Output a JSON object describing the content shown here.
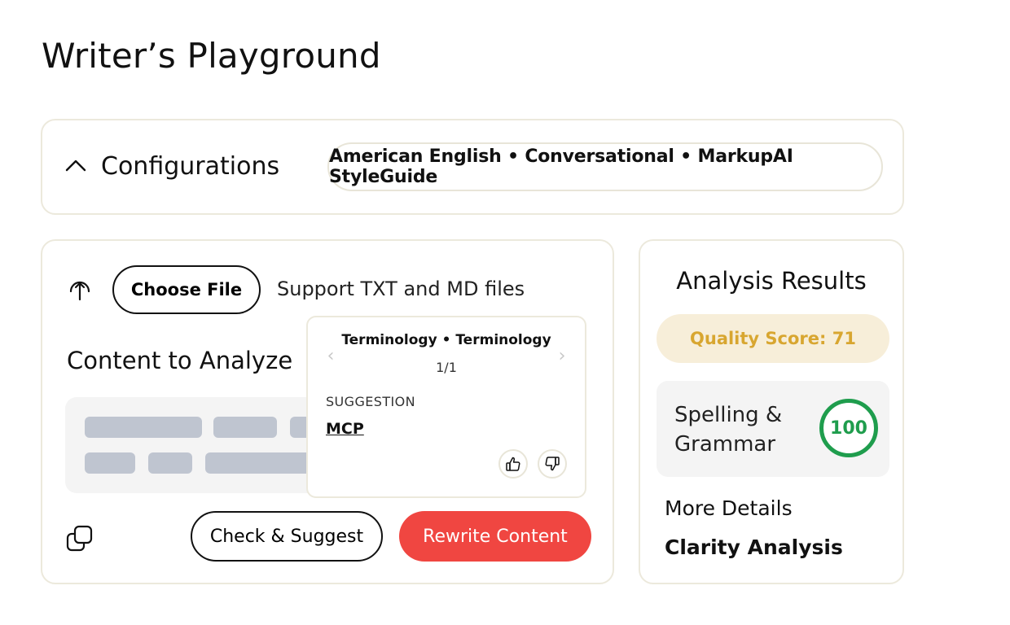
{
  "page": {
    "title": "Writer’s Playground"
  },
  "config": {
    "title": "Configurations",
    "toggle_icon": "chevron-up-icon",
    "summary": "American English • Conversational • MarkupAI StyleGuide"
  },
  "content": {
    "upload_icon": "upload-icon",
    "choose_file_label": "Choose File",
    "support_text": "Support TXT and MD files",
    "heading": "Content to Analyze",
    "copy_icon": "copy-icon",
    "check_label": "Check & Suggest",
    "rewrite_label": "Rewrite Content",
    "rewrite_color": "#f04641"
  },
  "popover": {
    "title": "Terminology • Terminology",
    "count": "1/1",
    "prev_icon": "chevron-left-icon",
    "next_icon": "chevron-right-icon",
    "label": "SUGGESTION",
    "suggestion": "MCP",
    "like_icon": "thumbs-up-icon",
    "dislike_icon": "thumbs-down-icon"
  },
  "analysis": {
    "title": "Analysis Results",
    "quality_score": "Quality Score: 71",
    "quality_color": "#d8a630",
    "spelling_label": "Spelling & Grammar",
    "spelling_score": "100",
    "spelling_color": "#1f9d4d",
    "more_details": "More Details",
    "clarity": "Clarity Analysis"
  }
}
